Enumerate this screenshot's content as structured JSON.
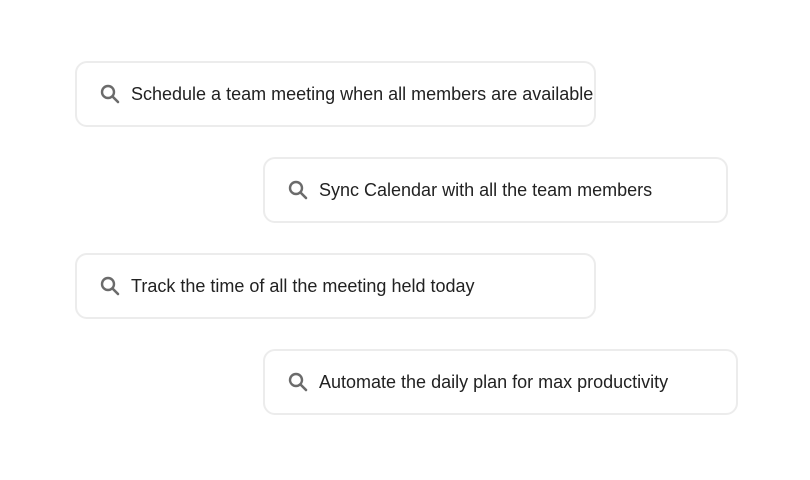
{
  "suggestions": [
    {
      "icon": "search-icon",
      "label": "Schedule a team meeting when all members are available"
    },
    {
      "icon": "search-icon",
      "label": "Sync Calendar with all the team members"
    },
    {
      "icon": "search-icon",
      "label": "Track the time of all the meeting held today"
    },
    {
      "icon": "search-icon",
      "label": "Automate the daily plan for max productivity"
    }
  ],
  "colors": {
    "border": "#ececec",
    "text": "#222222",
    "icon": "#6b6b6b"
  }
}
